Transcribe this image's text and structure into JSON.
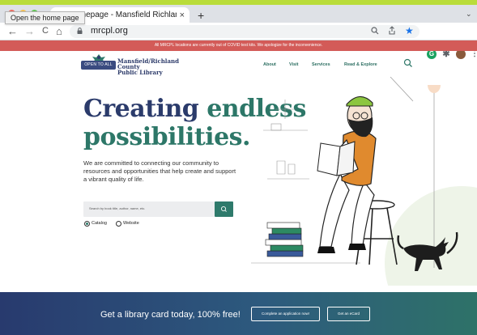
{
  "browser": {
    "tab_title": "Homepage - Mansfield Richland",
    "tab_close": "×",
    "new_tab": "+",
    "tab_menu": "⌄",
    "tooltip": "Open the home page",
    "url": "mrcpl.org",
    "nav": {
      "back": "←",
      "forward": "→",
      "reload": "C",
      "home": "⌂"
    },
    "icons": [
      "zoom-icon",
      "share-icon",
      "bookmark-star-icon",
      "extension-g-icon",
      "puzzle-icon",
      "profile-avatar-icon"
    ]
  },
  "alert": {
    "text": "All MRCPL locations are currently out of COVID test kits. We apologize for the inconvenience."
  },
  "header": {
    "logo_badge": "OPEN TO ALL",
    "logo_line1": "Mansfield/Richland County",
    "logo_line2": "Public Library",
    "menu": [
      "About",
      "Visit",
      "Services",
      "Read & Explore"
    ]
  },
  "hero": {
    "title_word1": "Creating",
    "title_word2": "endless",
    "title_line2": "possibilities.",
    "body": "We are committed to connecting our community to resources and opportunities that help create and support a vibrant quality of life.",
    "search_placeholder": "Search by book title, author, name, etc.",
    "radio_catalog": "Catalog",
    "radio_website": "Website",
    "selected": "Catalog"
  },
  "cta": {
    "text": "Get a library card today, 100% free!",
    "button_apply": "Complete an application now!",
    "button_ecard": "Get an eCard"
  },
  "colors": {
    "navy": "#2b3b6b",
    "teal": "#2d7768",
    "alert": "#d35b58",
    "chrome_top": "#b9dc3a"
  }
}
